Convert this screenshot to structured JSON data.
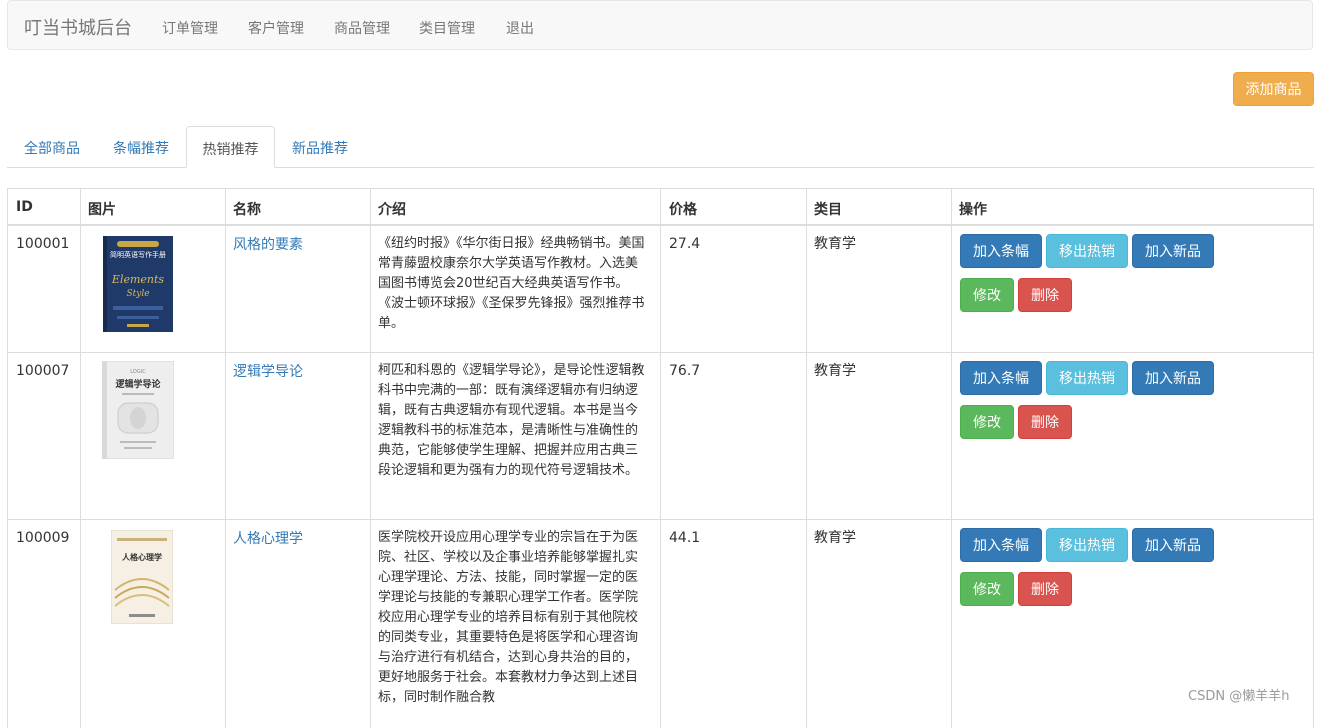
{
  "navbar": {
    "brand": "叮当书城后台",
    "links": [
      "订单管理",
      "客户管理",
      "商品管理",
      "类目管理",
      "退出"
    ]
  },
  "toolbar": {
    "add_product": "添加商品"
  },
  "tabs": [
    "全部商品",
    "条幅推荐",
    "热销推荐",
    "新品推荐"
  ],
  "active_tab": "热销推荐",
  "table": {
    "headers": [
      "ID",
      "图片",
      "名称",
      "介绍",
      "价格",
      "类目",
      "操作"
    ],
    "rows": [
      {
        "id": "100001",
        "name": "风格的要素",
        "description": "《纽约时报》《华尔街日报》经典畅销书。美国常青藤盟校康奈尔大学英语写作教材。入选美国图书博览会20世纪百大经典英语写作书。《波士顿环球报》《圣保罗先锋报》强烈推荐书单。",
        "price": "27.4",
        "category": "教育学",
        "cover_text": "简明英语写作手册",
        "cover_color": "#1f3a68"
      },
      {
        "id": "100007",
        "name": "逻辑学导论",
        "description": "柯匹和科恩的《逻辑学导论》，是导论性逻辑教科书中完满的一部：既有演绎逻辑亦有归纳逻辑，既有古典逻辑亦有现代逻辑。本书是当今逻辑教科书的标准范本，是清晰性与准确性的典范，它能够使学生理解、把握并应用古典三段论逻辑和更为强有力的现代符号逻辑技术。",
        "price": "76.7",
        "category": "教育学",
        "cover_text": "逻辑学导论",
        "cover_color": "#eeeeee"
      },
      {
        "id": "100009",
        "name": "人格心理学",
        "description": "医学院校开设应用心理学专业的宗旨在于为医院、社区、学校以及企事业培养能够掌握扎实心理学理论、方法、技能，同时掌握一定的医学理论与技能的专兼职心理学工作者。医学院校应用心理学专业的培养目标有别于其他院校的同类专业，其重要特色是将医学和心理咨询与治疗进行有机结合，达到心身共治的目的，更好地服务于社会。本套教材力争达到上述目标，同时制作融合教",
        "price": "44.1",
        "category": "教育学",
        "cover_text": "人格心理学",
        "cover_color": "#f5f0e3"
      }
    ],
    "actions": {
      "add_banner": "加入条幅",
      "remove_hot": "移出热销",
      "add_new": "加入新品",
      "edit": "修改",
      "delete": "删除"
    }
  },
  "watermark": "CSDN @懒羊羊h"
}
